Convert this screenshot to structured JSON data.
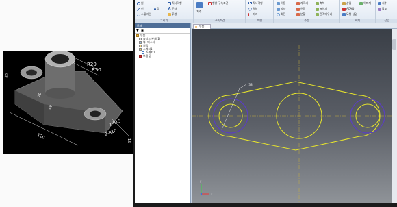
{
  "reference_image": {
    "dimensions": [
      "R20",
      "R30",
      "2-R15",
      "2-R10",
      "120",
      "30",
      "15",
      "20",
      "40"
    ]
  },
  "ribbon": {
    "groups": [
      {
        "label": "그리기",
        "items": [
          "원",
          "선",
          "스플라인",
          "점",
          "직사각형",
          "문자",
          "투영"
        ]
      },
      {
        "label": "구속조건",
        "items": [
          "치수",
          "형상 구속조건"
        ]
      },
      {
        "label": "패턴",
        "items": [
          "직사각형",
          "원형",
          "미러"
        ]
      },
      {
        "label": "수정",
        "items": [
          "이동",
          "복사",
          "회전",
          "자르기",
          "연장",
          "분할",
          "축척",
          "늘이기",
          "간격띄우기"
        ]
      },
      {
        "label": "배치",
        "items": [
          "삽입",
          "ACAD",
          "도형 삽입",
          "이미지"
        ]
      },
      {
        "label": "삽입",
        "items": [
          "치수",
          "참조"
        ]
      }
    ]
  },
  "browser": {
    "title": "모형",
    "toolbar_icons": [
      "filter-icon",
      "binoculars-icon"
    ],
    "items": [
      "부품1",
      "솔리드 본체(1)",
      "뷰: 마스터",
      "원점",
      "스케치1",
      "스케치1",
      "부품 끝"
    ]
  },
  "document_tab": "부품1",
  "sketch": {
    "dimension_label": "(38)",
    "colors": {
      "profile": "#e9e62c",
      "selected": "#5a3fbf",
      "centerline": "#d7c33a"
    }
  },
  "view_axes": {
    "x": "x",
    "y": "y"
  }
}
